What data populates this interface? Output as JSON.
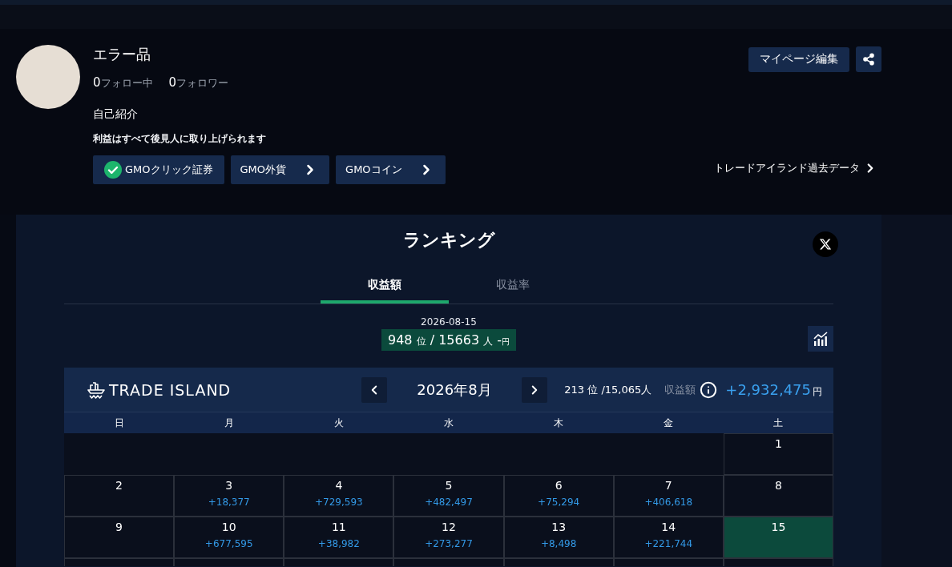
{
  "profile": {
    "name": "エラー品",
    "following": {
      "count": "0",
      "label": "フォロー中"
    },
    "followers": {
      "count": "0",
      "label": "フォロワー"
    },
    "bio_heading": "自己紹介",
    "bio": "利益はすべて後見人に取り上げられます",
    "accounts": [
      {
        "label": "GMOクリック証券",
        "linked": true
      },
      {
        "label": "GMO外貨",
        "linked": false
      },
      {
        "label": "GMOコイン",
        "linked": false
      }
    ],
    "edit_button": "マイページ編集",
    "past_data_link": "トレードアイランド過去データ"
  },
  "ranking": {
    "title": "ランキング",
    "tabs": [
      {
        "label": "収益額",
        "selected": true
      },
      {
        "label": "収益率",
        "selected": false
      }
    ],
    "date": "2026-08-15",
    "rank": "948",
    "rank_unit": "位",
    "total": "/ 15663",
    "total_unit": "人",
    "amount": "-",
    "currency": "円"
  },
  "calendar": {
    "logo": "TRADE ISLAND",
    "month": "2026年8月",
    "rank": "213",
    "rank_unit": "位",
    "total": "/15,065",
    "total_unit": "人",
    "metric_label": "収益額",
    "profit": "+2,932,475",
    "currency": "円",
    "weekdays": [
      "日",
      "月",
      "火",
      "水",
      "木",
      "金",
      "土"
    ],
    "weeks": [
      {
        "days": [
          {
            "kind": "blank"
          },
          {
            "kind": "blank"
          },
          {
            "kind": "blank"
          },
          {
            "kind": "blank"
          },
          {
            "kind": "blank"
          },
          {
            "kind": "blank"
          },
          {
            "kind": "day",
            "day": "1",
            "selected": false
          }
        ]
      },
      {
        "days": [
          {
            "kind": "day",
            "day": "2",
            "selected": false
          },
          {
            "kind": "day",
            "day": "3",
            "profit": "+18,377",
            "selected": false
          },
          {
            "kind": "day",
            "day": "4",
            "profit": "+729,593",
            "selected": false
          },
          {
            "kind": "day",
            "day": "5",
            "profit": "+482,497",
            "selected": false
          },
          {
            "kind": "day",
            "day": "6",
            "profit": "+75,294",
            "selected": false
          },
          {
            "kind": "day",
            "day": "7",
            "profit": "+406,618",
            "selected": false
          },
          {
            "kind": "day",
            "day": "8",
            "selected": false
          }
        ]
      },
      {
        "days": [
          {
            "kind": "day",
            "day": "9",
            "selected": false
          },
          {
            "kind": "day",
            "day": "10",
            "profit": "+677,595",
            "selected": false
          },
          {
            "kind": "day",
            "day": "11",
            "profit": "+38,982",
            "selected": false
          },
          {
            "kind": "day",
            "day": "12",
            "profit": "+273,277",
            "selected": false
          },
          {
            "kind": "day",
            "day": "13",
            "profit": "+8,498",
            "selected": false
          },
          {
            "kind": "day",
            "day": "14",
            "profit": "+221,744",
            "selected": false
          },
          {
            "kind": "day",
            "day": "15",
            "selected": true
          }
        ]
      },
      {
        "days": [
          {
            "kind": "cut"
          },
          {
            "kind": "cut"
          },
          {
            "kind": "cut"
          },
          {
            "kind": "cut"
          },
          {
            "kind": "cut"
          },
          {
            "kind": "cut"
          },
          {
            "kind": "cut"
          }
        ]
      }
    ]
  }
}
